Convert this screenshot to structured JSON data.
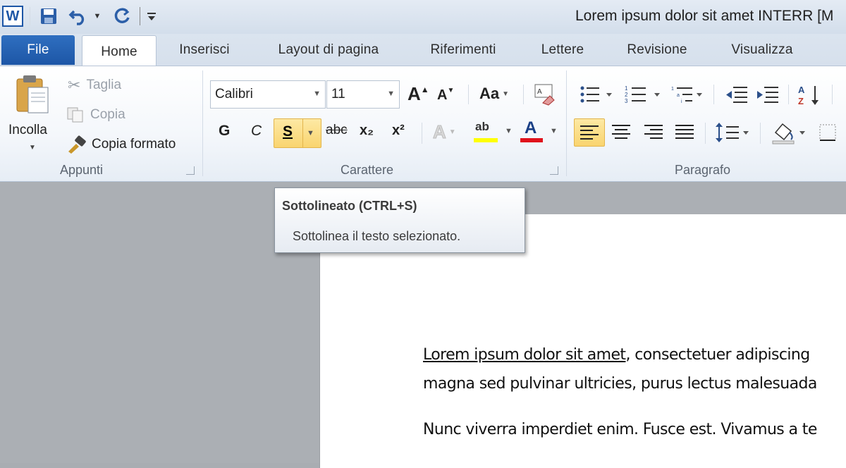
{
  "title_bar": {
    "app_icon_letter": "W",
    "title": "Lorem ipsum dolor sit amet INTERR [M"
  },
  "tabs": [
    {
      "label": "File"
    },
    {
      "label": "Home"
    },
    {
      "label": "Inserisci"
    },
    {
      "label": "Layout di pagina"
    },
    {
      "label": "Riferimenti"
    },
    {
      "label": "Lettere"
    },
    {
      "label": "Revisione"
    },
    {
      "label": "Visualizza"
    }
  ],
  "ribbon": {
    "clipboard": {
      "label": "Appunti",
      "paste_label": "Incolla",
      "cut_label": "Taglia",
      "copy_label": "Copia",
      "format_painter_label": "Copia formato"
    },
    "font": {
      "label": "Carattere",
      "font_name": "Calibri",
      "font_size": "11",
      "bold": "G",
      "italic": "C",
      "underline": "S",
      "strikethrough": "abc",
      "subscript": "x₂",
      "superscript": "x²",
      "change_case": "Aa",
      "grow": "A",
      "shrink": "A",
      "text_effects": "A",
      "highlight": "ab",
      "font_color": "A",
      "highlight_color": "#ffff00",
      "font_color_value": "#e0121c"
    },
    "paragraph": {
      "label": "Paragrafo"
    }
  },
  "tooltip": {
    "title": "Sottolineato (CTRL+S)",
    "description": "Sottolinea il testo selezionato."
  },
  "document": {
    "line1_underlined": "Lorem ipsum dolor sit amet",
    "line1_rest": ", consectetuer adipiscing",
    "line2": "magna sed pulvinar ultricies, purus lectus malesuada",
    "line3": "Nunc viverra imperdiet enim. Fusce est. Vivamus a te"
  },
  "colors": {
    "accent": "#1d56a6",
    "ribbon_border": "#b6c4d6",
    "active_highlight": "#f9d46f"
  }
}
